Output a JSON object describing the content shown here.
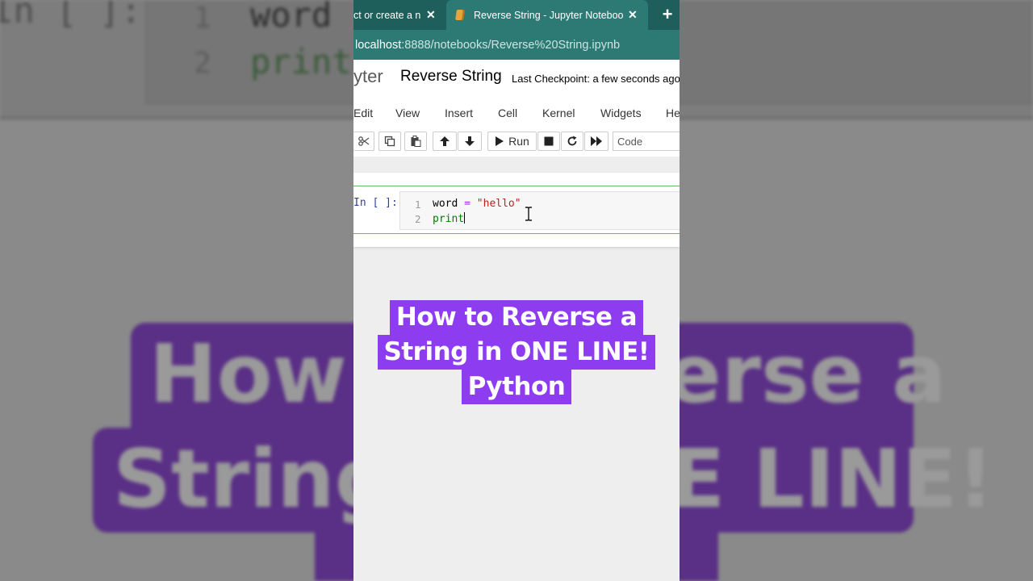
{
  "browser": {
    "tabs": [
      {
        "label": "ct or create a n",
        "active": false
      },
      {
        "label": "Reverse String - Jupyter Notebook",
        "active": true
      }
    ],
    "close_glyph": "✕",
    "new_tab_glyph": "+",
    "url_host": "localhost",
    "url_path": ":8888/notebooks/Reverse%20String.ipynb"
  },
  "jupyter": {
    "logo_text": "yter",
    "notebook_title": "Reverse String",
    "checkpoint": "Last Checkpoint: a few seconds ago",
    "menu": [
      "Edit",
      "View",
      "Insert",
      "Cell",
      "Kernel",
      "Widgets",
      "Help"
    ],
    "toolbar": {
      "run_label": "Run",
      "cell_type": "Code"
    },
    "cell": {
      "prompt": "In [ ]:",
      "line_numbers": [
        "1",
        "2"
      ],
      "line1": {
        "var": "word",
        "op": " = ",
        "str": "\"hello\""
      },
      "line2": "print"
    }
  },
  "overlay": {
    "lines": [
      "How to Reverse a",
      "String in ONE LINE!",
      "Python"
    ],
    "color": "#8d3cf0"
  },
  "background": {
    "prompt": "In [ ]:",
    "lines": [
      "1",
      "2"
    ],
    "code1": "word",
    "code2": "print",
    "word1": "How to Reverse a",
    "word2": "String in ONE LINE!"
  },
  "colors": {
    "tab_bar": "#1f5f5b",
    "url_bar": "#2d7a75",
    "selected_cell_border": "#66bb6a"
  }
}
